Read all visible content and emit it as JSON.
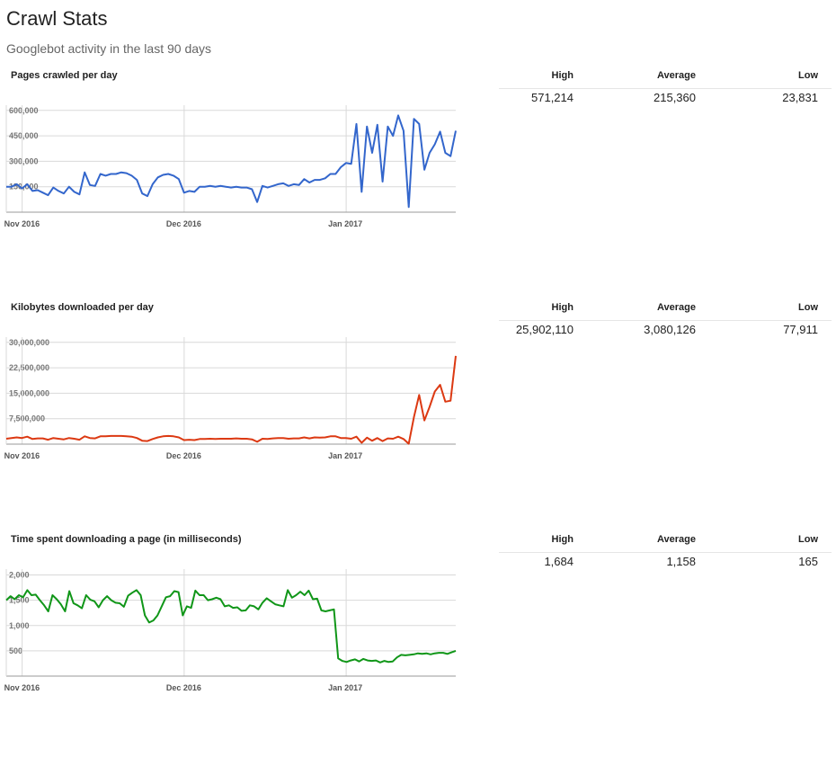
{
  "title": "Crawl Stats",
  "subtitle": "Googlebot activity in the last 90 days",
  "stat_headers": {
    "high": "High",
    "average": "Average",
    "low": "Low"
  },
  "sections": [
    {
      "title": "Pages crawled per day",
      "high": "571,214",
      "average": "215,360",
      "low": "23,831"
    },
    {
      "title": "Kilobytes downloaded per day",
      "high": "25,902,110",
      "average": "3,080,126",
      "low": "77,911"
    },
    {
      "title": "Time spent downloading a page (in milliseconds)",
      "high": "1,684",
      "average": "1,158",
      "low": "165"
    }
  ],
  "chart_data": [
    {
      "type": "line",
      "title": "Pages crawled per day",
      "color": "#3366cc",
      "x_ticks": [
        "Nov 2016",
        "Dec 2016",
        "Jan 2017"
      ],
      "x_tick_index": [
        2,
        33,
        64
      ],
      "y_ticks": [
        "600,000",
        "450,000",
        "300,000",
        "150,000"
      ],
      "y_tick_values": [
        600000,
        450000,
        300000,
        150000
      ],
      "ylim": [
        0,
        620000
      ],
      "values": [
        150000,
        150000,
        165000,
        140000,
        165000,
        125000,
        130000,
        115000,
        100000,
        145000,
        125000,
        110000,
        150000,
        120000,
        105000,
        235000,
        160000,
        155000,
        225000,
        215000,
        225000,
        225000,
        235000,
        230000,
        215000,
        190000,
        110000,
        95000,
        165000,
        205000,
        220000,
        225000,
        215000,
        195000,
        115000,
        125000,
        120000,
        150000,
        150000,
        155000,
        150000,
        155000,
        150000,
        145000,
        150000,
        145000,
        145000,
        135000,
        60000,
        155000,
        145000,
        155000,
        165000,
        170000,
        155000,
        165000,
        160000,
        195000,
        175000,
        190000,
        190000,
        200000,
        225000,
        225000,
        265000,
        290000,
        285000,
        520000,
        120000,
        505000,
        350000,
        515000,
        180000,
        505000,
        450000,
        570000,
        480000,
        30000,
        550000,
        520000,
        250000,
        350000,
        400000,
        475000,
        350000,
        330000,
        480000
      ]
    },
    {
      "type": "line",
      "title": "Kilobytes downloaded per day",
      "color": "#dc3912",
      "x_ticks": [
        "Nov 2016",
        "Dec 2016",
        "Jan 2017"
      ],
      "x_tick_index": [
        2,
        33,
        64
      ],
      "y_ticks": [
        "30,000,000",
        "22,500,000",
        "15,000,000",
        "7,500,000"
      ],
      "y_tick_values": [
        30000000,
        22500000,
        15000000,
        7500000
      ],
      "ylim": [
        0,
        31000000
      ],
      "values": [
        1600000,
        1800000,
        2000000,
        1800000,
        2200000,
        1500000,
        1700000,
        1700000,
        1300000,
        1800000,
        1600000,
        1400000,
        1800000,
        1600000,
        1300000,
        2300000,
        1800000,
        1700000,
        2300000,
        2300000,
        2400000,
        2400000,
        2400000,
        2300000,
        2200000,
        1800000,
        1000000,
        900000,
        1500000,
        2000000,
        2300000,
        2400000,
        2300000,
        2000000,
        1200000,
        1300000,
        1200000,
        1500000,
        1500000,
        1600000,
        1500000,
        1600000,
        1600000,
        1600000,
        1700000,
        1600000,
        1600000,
        1400000,
        700000,
        1600000,
        1500000,
        1700000,
        1800000,
        1800000,
        1600000,
        1700000,
        1700000,
        2000000,
        1700000,
        2000000,
        1900000,
        2000000,
        2300000,
        2300000,
        1800000,
        1800000,
        1600000,
        2200000,
        400000,
        1900000,
        1000000,
        1800000,
        900000,
        1700000,
        1600000,
        2200000,
        1500000,
        100000,
        8000000,
        14500000,
        7000000,
        11000000,
        15500000,
        17500000,
        12500000,
        12800000,
        26000000
      ]
    },
    {
      "type": "line",
      "title": "Time spent downloading a page (in milliseconds)",
      "color": "#109618",
      "x_ticks": [
        "Nov 2016",
        "Dec 2016",
        "Jan 2017"
      ],
      "x_tick_index": [
        2,
        33,
        64
      ],
      "y_ticks": [
        "2,000",
        "1,500",
        "1,000",
        "500"
      ],
      "y_tick_values": [
        2000,
        1500,
        1000,
        500
      ],
      "ylim": [
        0,
        2080
      ],
      "values": [
        1500,
        1580,
        1520,
        1600,
        1560,
        1700,
        1600,
        1610,
        1500,
        1400,
        1280,
        1600,
        1520,
        1420,
        1280,
        1680,
        1440,
        1400,
        1340,
        1600,
        1510,
        1480,
        1360,
        1500,
        1580,
        1500,
        1450,
        1440,
        1370,
        1590,
        1650,
        1700,
        1600,
        1200,
        1060,
        1100,
        1200,
        1380,
        1560,
        1580,
        1680,
        1660,
        1200,
        1380,
        1350,
        1690,
        1600,
        1600,
        1500,
        1520,
        1550,
        1520,
        1380,
        1400,
        1350,
        1360,
        1290,
        1300,
        1400,
        1380,
        1320,
        1450,
        1540,
        1480,
        1420,
        1400,
        1380,
        1700,
        1550,
        1600,
        1670,
        1600,
        1690,
        1520,
        1530,
        1300,
        1280,
        1300,
        1320,
        350,
        300,
        280,
        310,
        330,
        290,
        340,
        310,
        300,
        310,
        270,
        300,
        280,
        290,
        370,
        420,
        410,
        420,
        430,
        450,
        440,
        450,
        430,
        450,
        460,
        460,
        440,
        470,
        500
      ]
    }
  ]
}
